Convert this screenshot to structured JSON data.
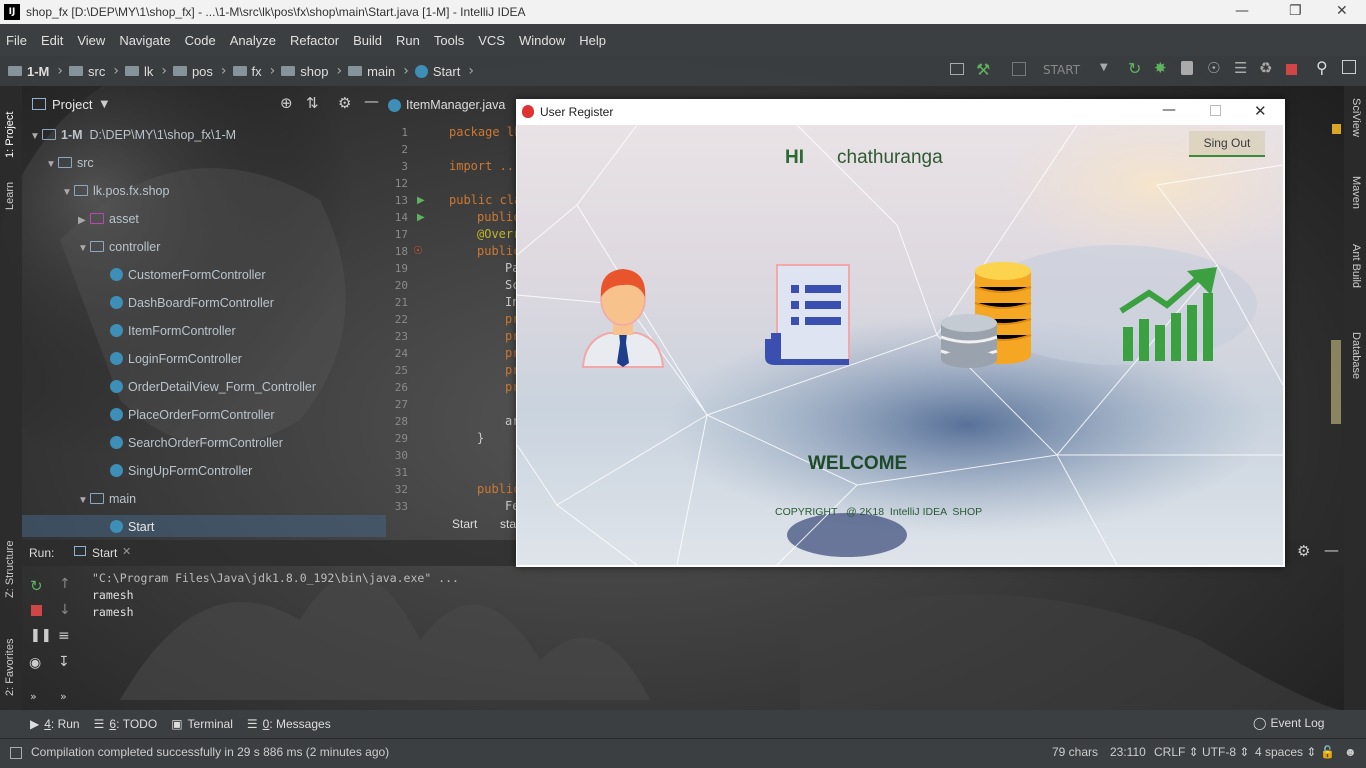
{
  "window": {
    "title": "shop_fx [D:\\DEP\\MY\\1\\shop_fx] - ...\\1-M\\src\\lk\\pos\\fx\\shop\\main\\Start.java [1-M] - IntelliJ IDEA",
    "app_icon": "IJ"
  },
  "menu": [
    "File",
    "Edit",
    "View",
    "Navigate",
    "Code",
    "Analyze",
    "Refactor",
    "Build",
    "Run",
    "Tools",
    "VCS",
    "Window",
    "Help"
  ],
  "breadcrumb": [
    "1-M",
    "src",
    "lk",
    "pos",
    "fx",
    "shop",
    "main",
    "Start"
  ],
  "run_config": "START",
  "side_tabs": {
    "left": [
      "1: Project",
      "Learn",
      "Z: Structure",
      "2: Favorites"
    ],
    "right": [
      "SciView",
      "Maven",
      "Ant Build",
      "Database"
    ]
  },
  "project": {
    "header": "Project",
    "root": "1-M",
    "root_path": "D:\\DEP\\MY\\1\\shop_fx\\1-M",
    "items": [
      {
        "label": "src",
        "kind": "folder"
      },
      {
        "label": "lk.pos.fx.shop",
        "kind": "folder"
      },
      {
        "label": "asset",
        "kind": "folder"
      },
      {
        "label": "controller",
        "kind": "folder"
      },
      {
        "label": "CustomerFormController",
        "kind": "class"
      },
      {
        "label": "DashBoardFormController",
        "kind": "class"
      },
      {
        "label": "ItemFormController",
        "kind": "class"
      },
      {
        "label": "LoginFormController",
        "kind": "class"
      },
      {
        "label": "OrderDetailView_Form_Controller",
        "kind": "class"
      },
      {
        "label": "PlaceOrderFormController",
        "kind": "class"
      },
      {
        "label": "SearchOrderFormController",
        "kind": "class"
      },
      {
        "label": "SingUpFormController",
        "kind": "class"
      },
      {
        "label": "main",
        "kind": "folder"
      },
      {
        "label": "Start",
        "kind": "class"
      }
    ]
  },
  "editor": {
    "tab": "ItemManager.java",
    "line_numbers": [
      "1",
      "2",
      "3",
      "12",
      "13",
      "14",
      "17",
      "18",
      "19",
      "20",
      "21",
      "22",
      "23",
      "24",
      "25",
      "26",
      "27",
      "28",
      "29",
      "30",
      "31",
      "32",
      "33"
    ],
    "code_lines": [
      "package lk",
      "",
      "import ...",
      "",
      "public cla",
      "public",
      "@Overr",
      "public",
      "Pa",
      "Sc",
      "In",
      "pr",
      "pr",
      "pr",
      "pr",
      "pr",
      "",
      "ar",
      "}",
      "",
      "",
      "public",
      "Fe"
    ],
    "breadcrumb_bottom": [
      "Start",
      "sta"
    ]
  },
  "run": {
    "label": "Run:",
    "tab": "Start",
    "output": [
      "\"C:\\Program Files\\Java\\jdk1.8.0_192\\bin\\java.exe\" ...",
      "ramesh",
      "ramesh"
    ]
  },
  "bottom_tools": [
    {
      "key": "4",
      "label": "Run"
    },
    {
      "key": "6",
      "label": "TODO"
    },
    {
      "key": "",
      "label": "Terminal"
    },
    {
      "key": "0",
      "label": "Messages"
    }
  ],
  "event_log": "Event Log",
  "status": {
    "message": "Compilation completed successfully in 29 s 886 ms (2 minutes ago)",
    "chars": "79 chars",
    "position": "23:110",
    "line_sep": "CRLF",
    "encoding": "UTF-8",
    "indent": "4 spaces"
  },
  "dialog": {
    "title": "User Register",
    "greeting": "HI",
    "username": "chathuranga",
    "signout": "Sing Out",
    "welcome": "WELCOME",
    "copyright": "COPYRIGHT   @ 2K18  IntelliJ IDEA  SHOP",
    "tiles": [
      "user-icon",
      "document-list-icon",
      "coins-database-icon",
      "growth-chart-icon"
    ]
  },
  "colors": {
    "green_text": "#1e6a2a",
    "accent_green": "#3aa040",
    "ide_bg": "#2b2b2b"
  }
}
